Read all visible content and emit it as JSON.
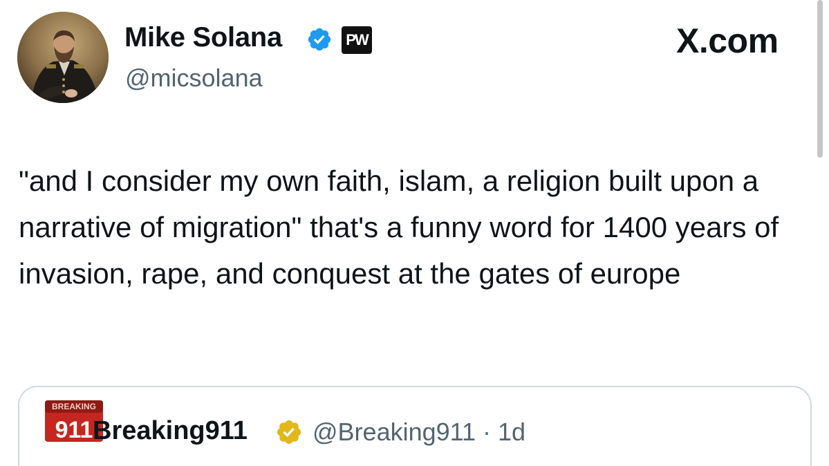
{
  "author": {
    "display_name": "Mike Solana",
    "handle": "@micsolana",
    "badge_text": "PW"
  },
  "brand": {
    "site_label": "X.com"
  },
  "tweet": {
    "text": "\"and I consider my own faith, islam, a religion built upon a narrative of migration\" that's a funny word for 1400 years of invasion, rape, and conquest at the gates of europe"
  },
  "quoted": {
    "avatar_small_text": "BREAKING",
    "avatar_big_text": "911",
    "display_name": "Breaking911",
    "handle_time": "@Breaking911 · 1d"
  },
  "colors": {
    "verified_blue": "#1d9bf0",
    "verified_gold": "#e2b719",
    "secondary_text": "#536471",
    "border": "#cfd9de",
    "breaking_red": "#c4271f"
  },
  "icons": {
    "verified": "verified-badge-icon",
    "gold_verified": "gold-verified-badge-icon"
  }
}
